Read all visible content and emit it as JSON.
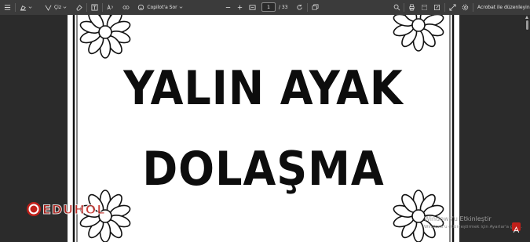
{
  "toolbar": {
    "draw_label": "Çiz",
    "copilot_label": "Copilot'a Sor",
    "page_current": "1",
    "page_total": "/ 33",
    "acrobat_label": "Acrobat ile düzenleyin"
  },
  "document": {
    "title_line1": "YALIN AYAK",
    "title_line2": "DOLAŞMA"
  },
  "watermark": {
    "brand": "EDUHOL"
  },
  "activation": {
    "title": "Windows'u Etkinleştir",
    "subtitle": "Windows'u etkinleştirmek için Ayarlar'a gidin."
  },
  "colors": {
    "toolbar_bg": "#3b3b3b",
    "viewer_bg": "#2b2b2b",
    "page_bg": "#ffffff",
    "ink": "#0d0d0d",
    "watermark_red": "#c0201a"
  },
  "icons": [
    "list-icon",
    "highlighter-icon",
    "draw-icon",
    "eraser-icon",
    "text-box-icon",
    "read-aloud-icon",
    "translate-icon",
    "copilot-icon",
    "zoom-out-icon",
    "zoom-in-icon",
    "fit-page-icon",
    "rotate-icon",
    "page-view-icon",
    "search-icon",
    "print-icon",
    "save-icon",
    "save-as-icon",
    "full-screen-icon",
    "settings-icon",
    "pdf-icon"
  ]
}
